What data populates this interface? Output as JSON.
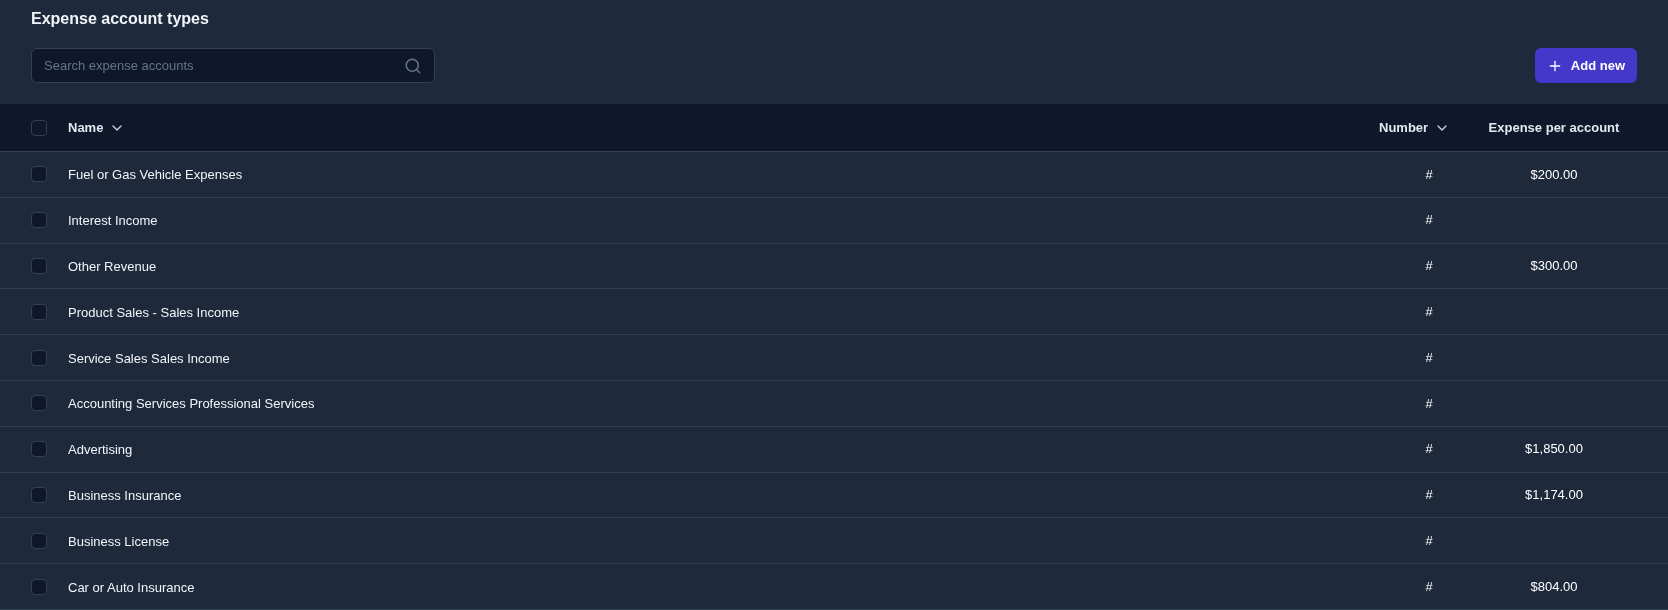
{
  "title": "Expense account types",
  "search": {
    "placeholder": "Search expense accounts"
  },
  "add_button": {
    "label": "Add new"
  },
  "table": {
    "select_all": {
      "checked": false
    },
    "columns": [
      {
        "label": "Name",
        "sortable": true
      },
      {
        "label": "Number",
        "sortable": true
      },
      {
        "label": "Expense per account",
        "sortable": false
      }
    ],
    "rows": [
      {
        "checked": false,
        "name": "Fuel or Gas Vehicle Expenses",
        "number": "#",
        "expense": "$200.00"
      },
      {
        "checked": false,
        "name": "Interest Income",
        "number": "#"
      },
      {
        "checked": false,
        "name": "Other Revenue",
        "number": "#",
        "expense": "$300.00"
      },
      {
        "checked": false,
        "name": "Product Sales - Sales Income",
        "number": "#"
      },
      {
        "checked": false,
        "name": "Service Sales Sales Income",
        "number": "#"
      },
      {
        "checked": false,
        "name": "Accounting Services Professional Services",
        "number": "#"
      },
      {
        "checked": false,
        "name": "Advertising",
        "number": "#",
        "expense": "$1,850.00"
      },
      {
        "checked": false,
        "name": "Business Insurance",
        "number": "#",
        "expense": "$1,174.00"
      },
      {
        "checked": false,
        "name": "Business License",
        "number": "#"
      },
      {
        "checked": false,
        "name": "Car or Auto Insurance",
        "number": "#",
        "expense": "$804.00"
      }
    ]
  }
}
